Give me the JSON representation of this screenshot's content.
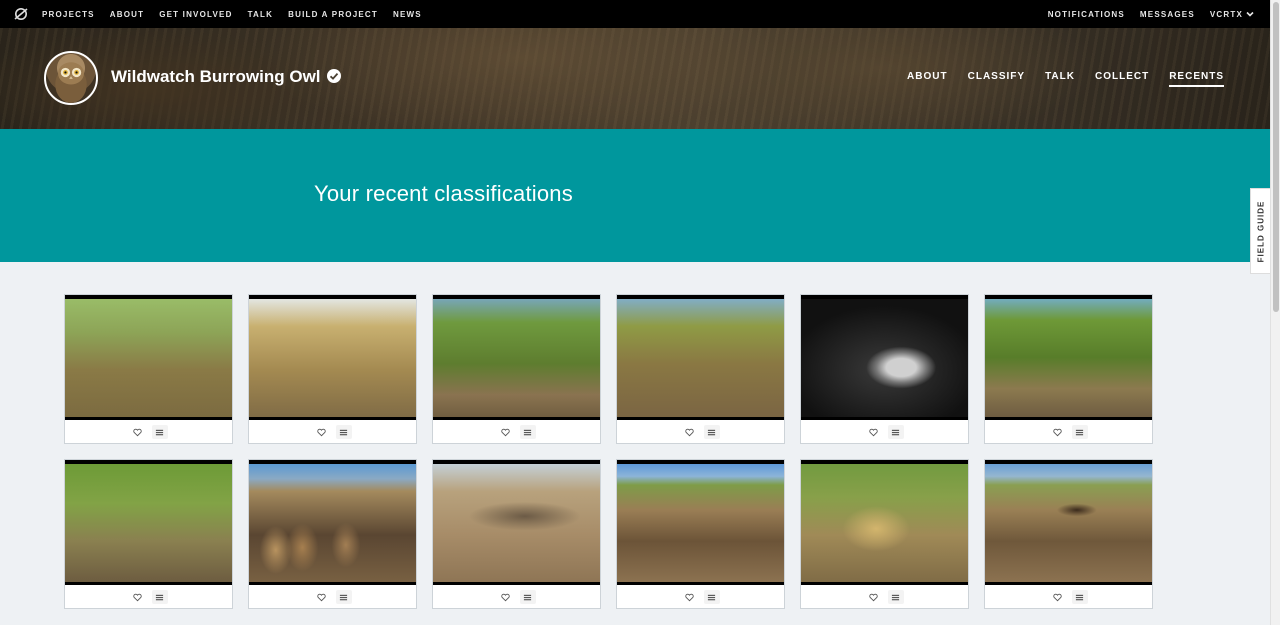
{
  "topbar": {
    "nav": [
      "PROJECTS",
      "ABOUT",
      "GET INVOLVED",
      "TALK",
      "BUILD A PROJECT",
      "NEWS"
    ],
    "right": [
      "NOTIFICATIONS",
      "MESSAGES",
      "VCRTX"
    ]
  },
  "project": {
    "title": "Wildwatch Burrowing Owl",
    "nav": [
      "ABOUT",
      "CLASSIFY",
      "TALK",
      "COLLECT",
      "RECENTS"
    ],
    "active_tab": "RECENTS"
  },
  "banner": {
    "heading": "Your recent classifications"
  },
  "field_guide": "FIELD GUIDE",
  "colors": {
    "teal": "#00979d",
    "topbar": "#000000",
    "background": "#eef1f4"
  },
  "recents": [
    {
      "scene": "s-grass"
    },
    {
      "scene": "s-dry"
    },
    {
      "scene": "s-green"
    },
    {
      "scene": "s-green2"
    },
    {
      "scene": "s-night"
    },
    {
      "scene": "s-leafy"
    },
    {
      "scene": "s-tall"
    },
    {
      "scene": "s-owls"
    },
    {
      "scene": "s-flat"
    },
    {
      "scene": "s-sky"
    },
    {
      "scene": "s-rocks"
    },
    {
      "scene": "s-sky2"
    }
  ]
}
